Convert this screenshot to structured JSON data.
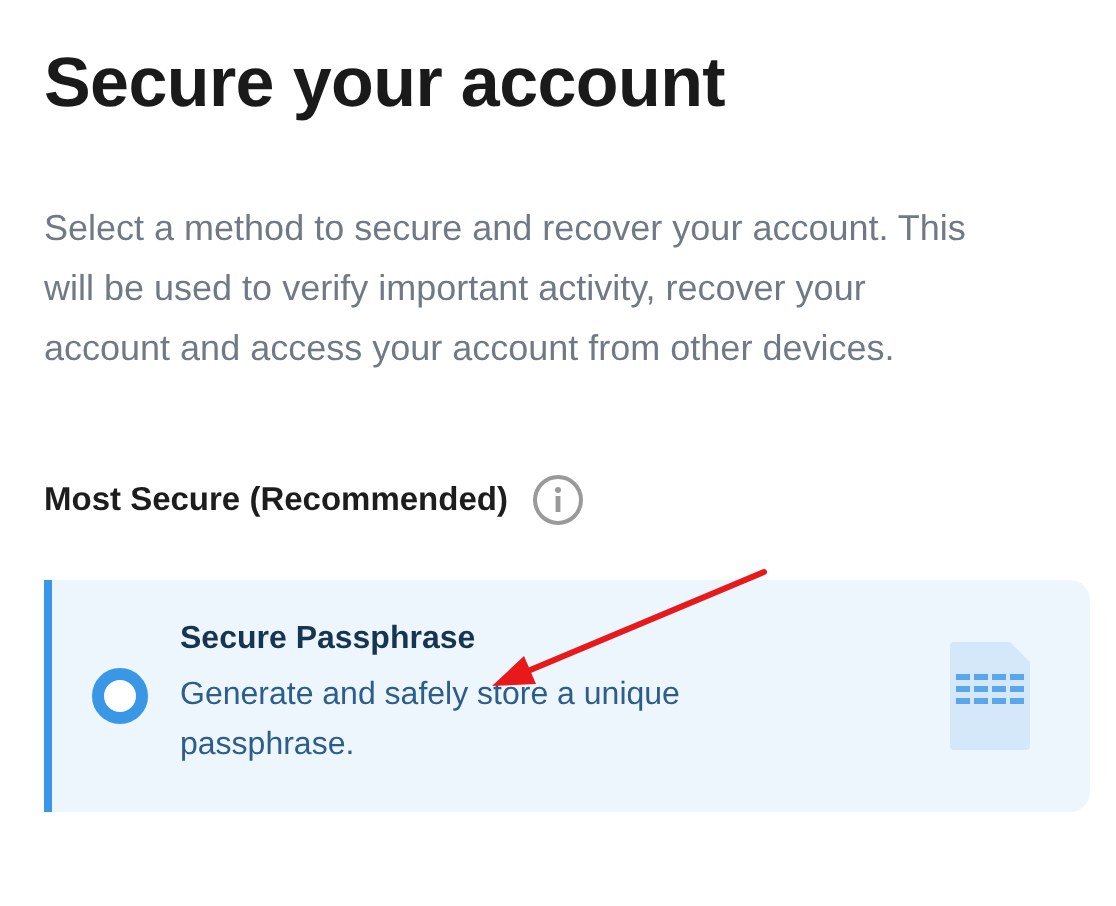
{
  "heading": "Secure your account",
  "description": "Select a method to secure and recover your account. This will be used to verify important activity, recover your account and access your account from other devices.",
  "section": {
    "label": "Most Secure (Recommended)"
  },
  "options": [
    {
      "title": "Secure Passphrase",
      "description": "Generate and safely store a unique passphrase.",
      "selected": true
    }
  ]
}
